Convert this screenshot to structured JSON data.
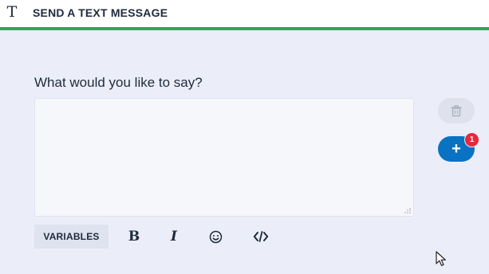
{
  "header": {
    "icon": "text-type-icon",
    "icon_glyph": "T",
    "title": "SEND A TEXT MESSAGE",
    "accent_color": "#2eaa4f"
  },
  "form": {
    "prompt": "What would you like to say?",
    "message_value": "",
    "message_placeholder": ""
  },
  "toolbar": {
    "variables_label": "VARIABLES",
    "bold_icon": "bold-icon",
    "italic_icon": "italic-icon",
    "emoji_icon": "emoji-icon",
    "code_icon": "code-icon",
    "bold_glyph": "B",
    "italic_glyph": "I"
  },
  "actions": {
    "delete_icon": "trash-icon",
    "add_icon": "plus-icon",
    "add_glyph": "+",
    "badge_count": "1",
    "add_color": "#0a72c2",
    "badge_color": "#e8283b"
  }
}
